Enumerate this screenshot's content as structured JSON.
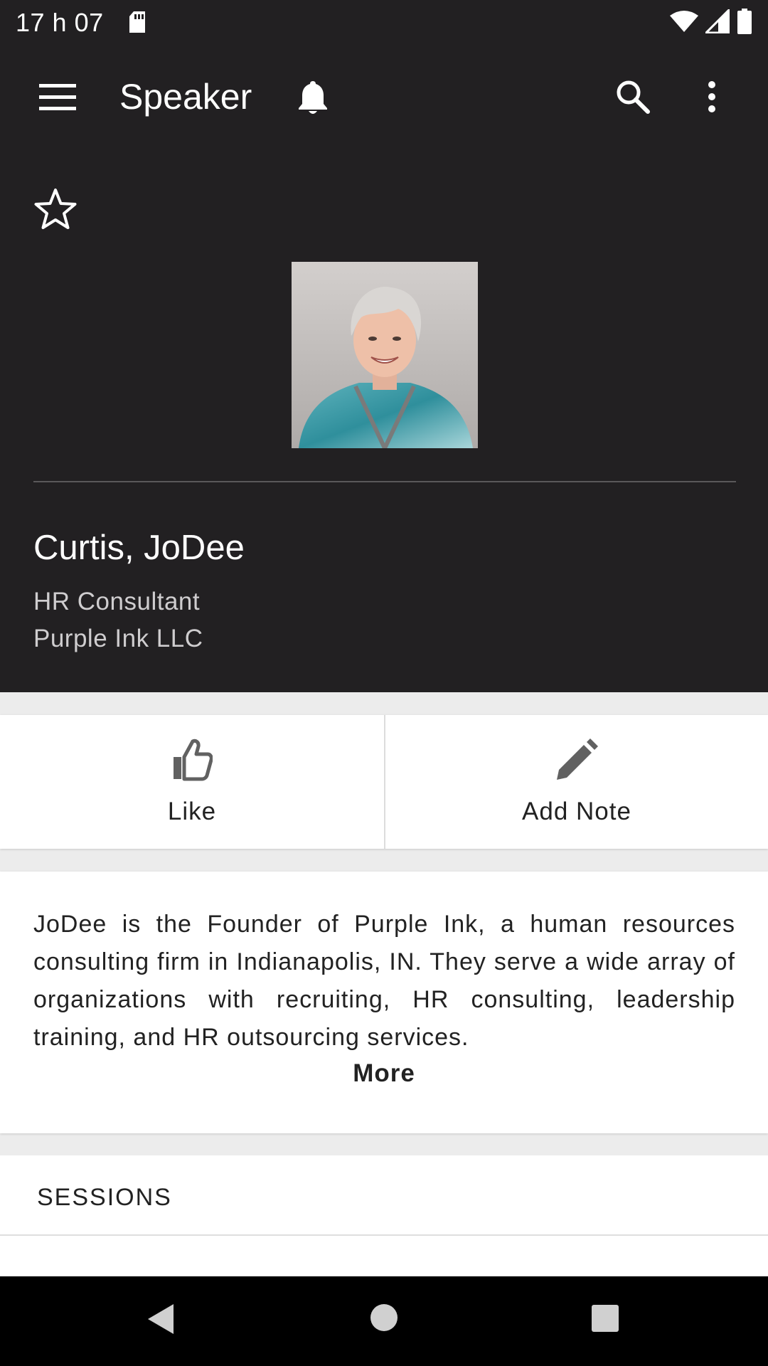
{
  "status_bar": {
    "time": "17 h 07",
    "icons": [
      "sd-card-icon",
      "wifi-icon",
      "signal-icon",
      "battery-icon"
    ]
  },
  "app_bar": {
    "title": "Speaker",
    "icons": [
      "menu-icon",
      "bell-icon",
      "search-icon",
      "more-vert-icon"
    ]
  },
  "speaker": {
    "name": "Curtis, JoDee",
    "title": "HR Consultant",
    "company": "Purple Ink LLC"
  },
  "actions": {
    "like_label": "Like",
    "add_note_label": "Add Note"
  },
  "bio": {
    "text": "JoDee is the Founder of Purple Ink, a human resources consulting firm in Indianapolis, IN. They serve a wide array of organizations with recruiting, HR consulting, leadership training, and HR outsourcing services.",
    "more_label": "More"
  },
  "sessions": {
    "header": "SESSIONS"
  },
  "nav_bar": {
    "icons": [
      "back-icon",
      "home-icon",
      "recents-icon"
    ]
  },
  "colors": {
    "header_bg": "#222022",
    "card_bg": "#ffffff",
    "page_bg": "#ececec",
    "icon_gray": "#616161"
  }
}
